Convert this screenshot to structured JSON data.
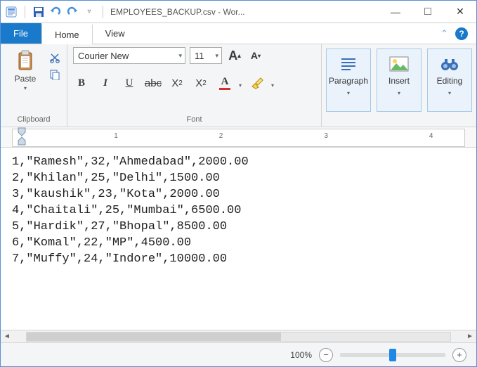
{
  "window": {
    "title": "EMPLOYEES_BACKUP.csv - Wor..."
  },
  "tabs": {
    "file": "File",
    "home": "Home",
    "view": "View"
  },
  "ribbon": {
    "clipboard": {
      "label": "Clipboard",
      "paste": "Paste"
    },
    "font": {
      "label": "Font",
      "family": "Courier New",
      "size": "11",
      "grow_A": "A",
      "shrink_A": "A",
      "bold": "B",
      "italic": "I",
      "underline": "U",
      "strike": "abc",
      "subscript": "X",
      "subscript_small": "2",
      "superscript": "X",
      "superscript_small": "2",
      "fontcolor": "A"
    },
    "paragraph": {
      "label": "Paragraph"
    },
    "insert": {
      "label": "Insert"
    },
    "editing": {
      "label": "Editing"
    }
  },
  "ruler": {
    "marks": [
      "1",
      "2",
      "3",
      "4"
    ]
  },
  "document": {
    "lines": [
      "1,\"Ramesh\",32,\"Ahmedabad\",2000.00",
      "2,\"Khilan\",25,\"Delhi\",1500.00",
      "3,\"kaushik\",23,\"Kota\",2000.00",
      "4,\"Chaitali\",25,\"Mumbai\",6500.00",
      "5,\"Hardik\",27,\"Bhopal\",8500.00",
      "6,\"Komal\",22,\"MP\",4500.00",
      "7,\"Muffy\",24,\"Indore\",10000.00"
    ]
  },
  "status": {
    "zoom_label": "100%"
  },
  "icons": {
    "minimize": "—",
    "maximize": "□",
    "close": "✕",
    "collapse": "⌃",
    "help": "?",
    "qat_dd": "▿",
    "caret": "▾",
    "minus": "−",
    "plus": "+",
    "left": "◄",
    "right": "►"
  }
}
